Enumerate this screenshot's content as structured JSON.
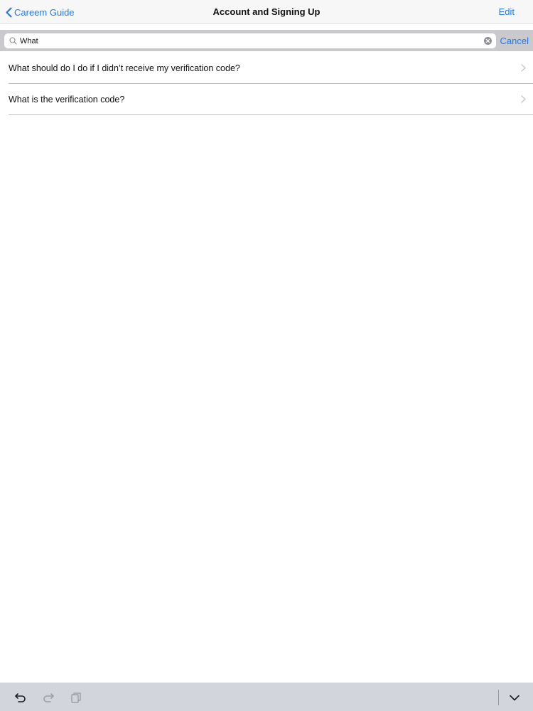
{
  "nav": {
    "back_label": "Careem Guide",
    "title": "Account and Signing Up",
    "edit_label": "Edit"
  },
  "search": {
    "value": "What",
    "cancel_label": "Cancel"
  },
  "results": [
    {
      "label": "What should do I do if I didn’t receive my verification code?"
    },
    {
      "label": "What is the verification code?"
    }
  ],
  "colors": {
    "accent": "#1a7cf4",
    "search_bar_bg": "#c9c9ce",
    "toolbar_bg": "#d2d5db",
    "separator": "#bdbdbd"
  },
  "icons": {
    "back": "chevron-left-icon",
    "search": "search-icon",
    "clear": "clear-icon",
    "row": "chevron-right-icon",
    "undo": "undo-icon",
    "redo": "redo-icon",
    "paste": "paste-icon",
    "dismiss_keyboard": "chevron-down-icon"
  }
}
